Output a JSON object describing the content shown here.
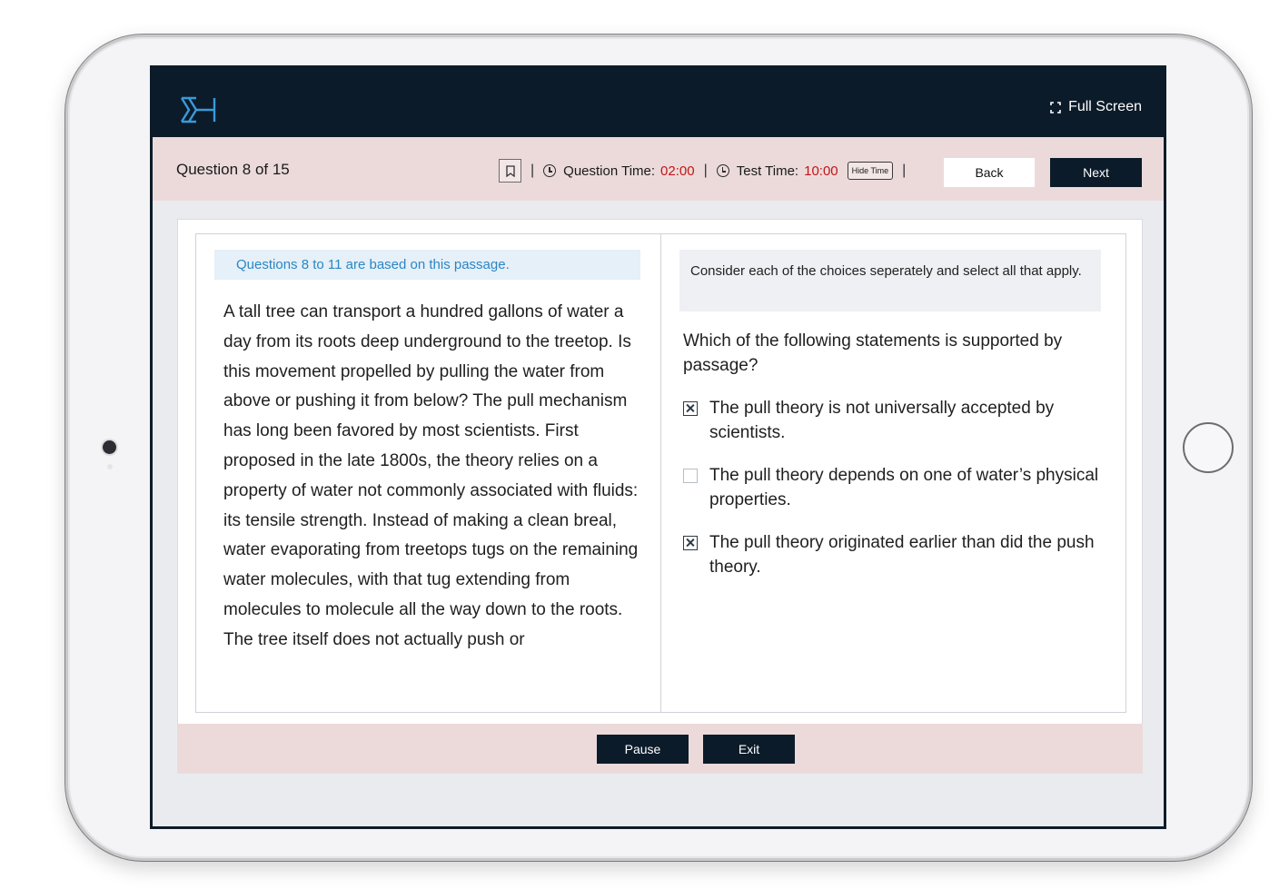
{
  "header": {
    "logo_icon": "brand-chevrons-icon",
    "fullscreen_label": "Full Screen"
  },
  "question_bar": {
    "question_counter": "Question 8 of 15",
    "question_time_label": "Question Time:",
    "question_time_value": "02:00",
    "test_time_label": "Test Time:",
    "test_time_value": "10:00",
    "hide_time_label": "Hide Time",
    "separator": "|",
    "back_label": "Back",
    "next_label": "Next"
  },
  "passage": {
    "header": "Questions 8 to 11 are based on this passage.",
    "text": "A tall tree can transport a hundred gallons of water a day from its roots deep underground to the treetop. Is this movement propelled by pulling the water from above or pushing it from below? The pull mechanism has long been favored by most scientists. First proposed in the late 1800s, the theory relies on a property of water not commonly associated with fluids: its tensile strength. Instead of making a clean breal, water evaporating from treetops tugs on the remaining water molecules, with that tug extending from molecules to molecule all the way down to the roots. The tree itself does not actually push or"
  },
  "question": {
    "instruction": "Consider each of the choices seperately and select all that apply.",
    "prompt": "Which of the following statements is supported by passage?",
    "choices": [
      {
        "text": "The pull theory is not universally accepted by scientists.",
        "checked": true
      },
      {
        "text": "The pull theory depends on one of water’s physical properties.",
        "checked": false
      },
      {
        "text": "The pull theory originated earlier than did the push theory.",
        "checked": true
      }
    ]
  },
  "footer": {
    "pause_label": "Pause",
    "exit_label": "Exit"
  },
  "colors": {
    "navy": "#0c1b2a",
    "timer_red": "#c01515",
    "bar_pink": "#ecdadb",
    "passage_blue": "#2b86c4"
  }
}
